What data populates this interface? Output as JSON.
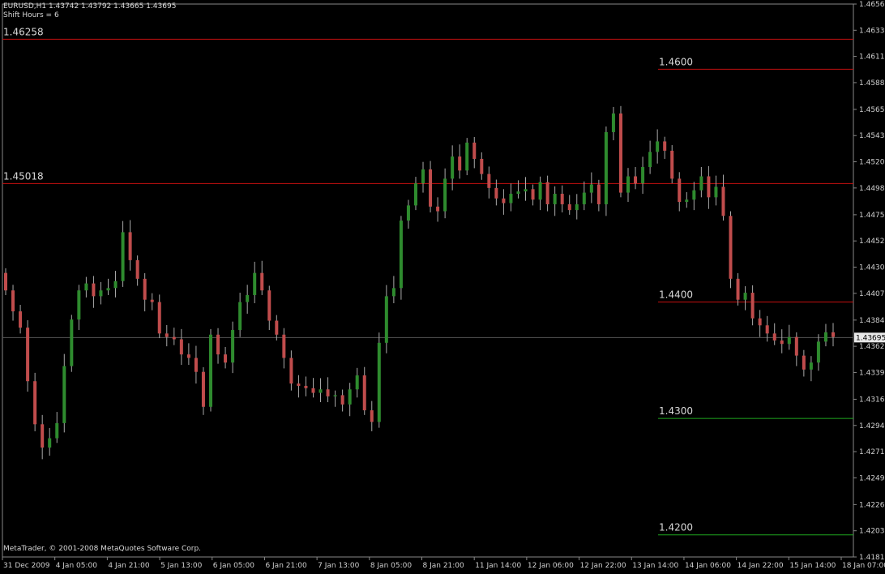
{
  "header": {
    "line1": "EURUSD,H1  1.43742 1.43792 1.43665 1.43695",
    "line2": "Shift Hours = 6"
  },
  "footer": {
    "copyright": "MetaTrader, © 2001-2008 MetaQuotes Software Corp."
  },
  "colors": {
    "background": "#000000",
    "bull_candle": "#2e8b2e",
    "bear_candle": "#c04c4c",
    "wick": "#aaaaaa",
    "red_level": "#c41010",
    "green_level": "#1fa81f",
    "grid": "#2a2a2a",
    "axis_text": "#cfcfcf"
  },
  "chart_data": {
    "type": "candlestick",
    "symbol": "EURUSD",
    "timeframe": "H1",
    "ylim": [
      1.4181,
      1.4656
    ],
    "price_ticks": [
      "1.46560",
      "1.46335",
      "1.46110",
      "1.45885",
      "1.45655",
      "1.45430",
      "1.45205",
      "1.44980",
      "1.44750",
      "1.44525",
      "1.44300",
      "1.44075",
      "1.43845",
      "1.43620",
      "1.43395",
      "1.43165",
      "1.42940",
      "1.42715",
      "1.42490",
      "1.42260",
      "1.42035",
      "1.41810"
    ],
    "time_ticks": [
      "31 Dec 2009",
      "4 Jan 05:00",
      "4 Jan 21:00",
      "5 Jan 13:00",
      "6 Jan 05:00",
      "6 Jan 21:00",
      "7 Jan 13:00",
      "8 Jan 05:00",
      "8 Jan 21:00",
      "11 Jan 14:00",
      "12 Jan 06:00",
      "12 Jan 22:00",
      "13 Jan 14:00",
      "14 Jan 06:00",
      "14 Jan 22:00",
      "15 Jan 14:00",
      "18 Jan 07:00"
    ],
    "current_price": "1.43695",
    "levels": [
      {
        "price": 1.46258,
        "label": "1.46258",
        "color": "red",
        "span": "full"
      },
      {
        "price": 1.46,
        "label": "1.4600",
        "color": "red",
        "span": "right"
      },
      {
        "price": 1.45018,
        "label": "1.45018",
        "color": "red",
        "span": "full"
      },
      {
        "price": 1.44,
        "label": "1.4400",
        "color": "red",
        "span": "right"
      },
      {
        "price": 1.43,
        "label": "1.4300",
        "color": "green",
        "span": "right"
      },
      {
        "price": 1.42,
        "label": "1.4200",
        "color": "green",
        "span": "right"
      }
    ],
    "closes": [
      1.441,
      1.4392,
      1.4378,
      1.4332,
      1.4295,
      1.4275,
      1.4283,
      1.4296,
      1.4345,
      1.4385,
      1.441,
      1.4416,
      1.4405,
      1.441,
      1.4412,
      1.4418,
      1.446,
      1.4436,
      1.442,
      1.4402,
      1.44,
      1.4373,
      1.437,
      1.4368,
      1.4355,
      1.4352,
      1.434,
      1.431,
      1.4372,
      1.4355,
      1.4348,
      1.4376,
      1.44,
      1.4406,
      1.4425,
      1.441,
      1.4384,
      1.4372,
      1.4352,
      1.433,
      1.4328,
      1.4326,
      1.4322,
      1.4325,
      1.4319,
      1.432,
      1.4312,
      1.4325,
      1.4337,
      1.4307,
      1.4297,
      1.4365,
      1.4405,
      1.4412,
      1.447,
      1.4483,
      1.4502,
      1.4514,
      1.4482,
      1.4478,
      1.4506,
      1.4525,
      1.4513,
      1.4537,
      1.4523,
      1.451,
      1.4498,
      1.4489,
      1.4485,
      1.4493,
      1.4495,
      1.4497,
      1.4488,
      1.4503,
      1.4484,
      1.4493,
      1.4484,
      1.4479,
      1.4484,
      1.4494,
      1.4501,
      1.4484,
      1.4546,
      1.4562,
      1.4494,
      1.4508,
      1.4502,
      1.4516,
      1.4529,
      1.4538,
      1.453,
      1.4506,
      1.4486,
      1.4488,
      1.4496,
      1.4508,
      1.449,
      1.4499,
      1.4474,
      1.442,
      1.4402,
      1.4408,
      1.4386,
      1.438,
      1.4373,
      1.4367,
      1.4364,
      1.437,
      1.4354,
      1.4342,
      1.4348,
      1.4366,
      1.4374,
      1.437
    ]
  }
}
